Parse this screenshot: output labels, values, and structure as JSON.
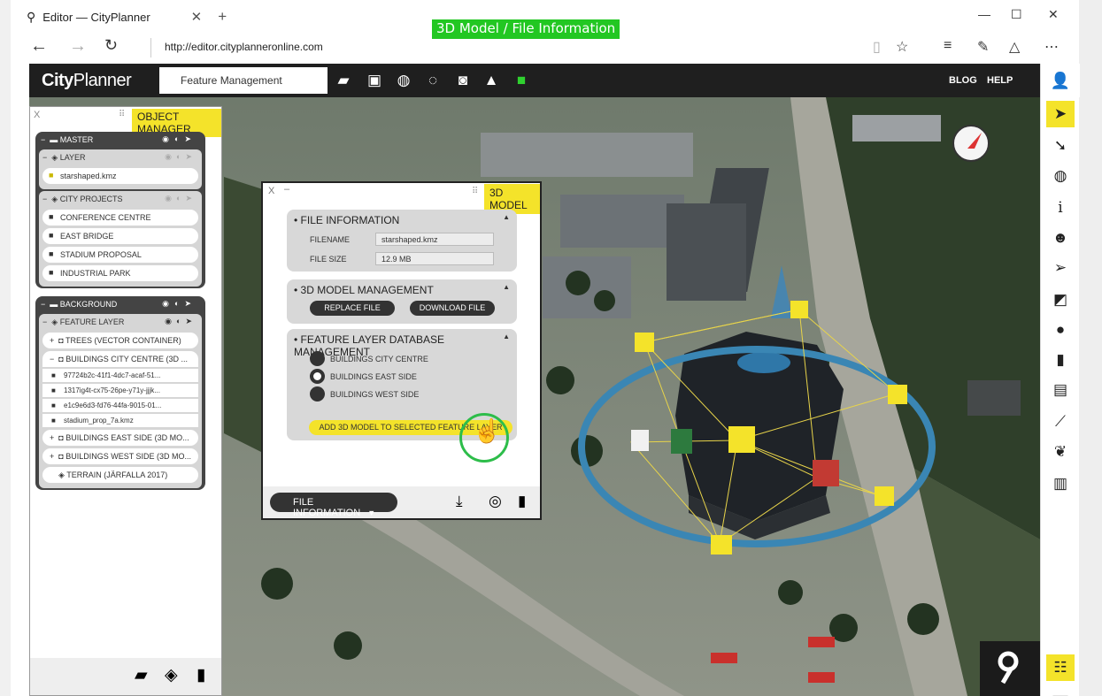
{
  "banner": "3D Model / File Information",
  "browser": {
    "tab_title": "Editor — CityPlanner",
    "url": "http://editor.cityplanneronline.com"
  },
  "app": {
    "logo_bold": "City",
    "logo_light": "Planner",
    "module": "Feature Management",
    "blog": "BLOG",
    "help": "HELP"
  },
  "object_manager": {
    "close": "X",
    "title": "OBJECT MANAGER",
    "master": "MASTER",
    "layer": "LAYER",
    "layer_file": "starshaped.kmz",
    "city_projects": "CITY PROJECTS",
    "projects": [
      "CONFERENCE CENTRE",
      "EAST BRIDGE",
      "STADIUM PROPOSAL",
      "INDUSTRIAL PARK"
    ],
    "background": "BACKGROUND",
    "feature_layer": "FEATURE LAYER",
    "trees": "TREES (VECTOR CONTAINER)",
    "bcc": "BUILDINGS CITY CENTRE (3D ...",
    "bcc_children": [
      "97724b2c-41f1-4dc7-acaf-51...",
      "1317ig4t-cx75-26pe-y71y-jjjk...",
      "e1c9e6d3-fd76-44fa-9015-01...",
      "stadium_prop_7a.kmz"
    ],
    "bes": "BUILDINGS EAST SIDE (3D MO...",
    "bws": "BUILDINGS WEST SIDE (3D MO...",
    "terrain": "TERRAIN (JÄRFALLA 2017)"
  },
  "model_panel": {
    "close": "X",
    "min": "–",
    "title": "3D MODEL",
    "file_info_title": "FILE INFORMATION",
    "filename_label": "FILENAME",
    "filename_value": "starshaped.kmz",
    "filesize_label": "FILE SIZE",
    "filesize_value": "12.9 MB",
    "mgmt_title": "3D MODEL MANAGEMENT",
    "replace": "REPLACE FILE",
    "download": "DOWNLOAD FILE",
    "db_title": "FEATURE LAYER DATABASE MANAGEMENT",
    "layers": [
      "BUILDINGS CITY CENTRE",
      "BUILDINGS EAST SIDE",
      "BUILDINGS WEST SIDE"
    ],
    "add_btn": "ADD 3D MODEL TO SELECTED FEATURE LAYER",
    "footer_dropdown": "FILE INFORMATION"
  },
  "colors": {
    "accent": "#f4e32a",
    "banner": "#22c722",
    "header": "#1f1f1f",
    "ring": "#3a86b4"
  }
}
